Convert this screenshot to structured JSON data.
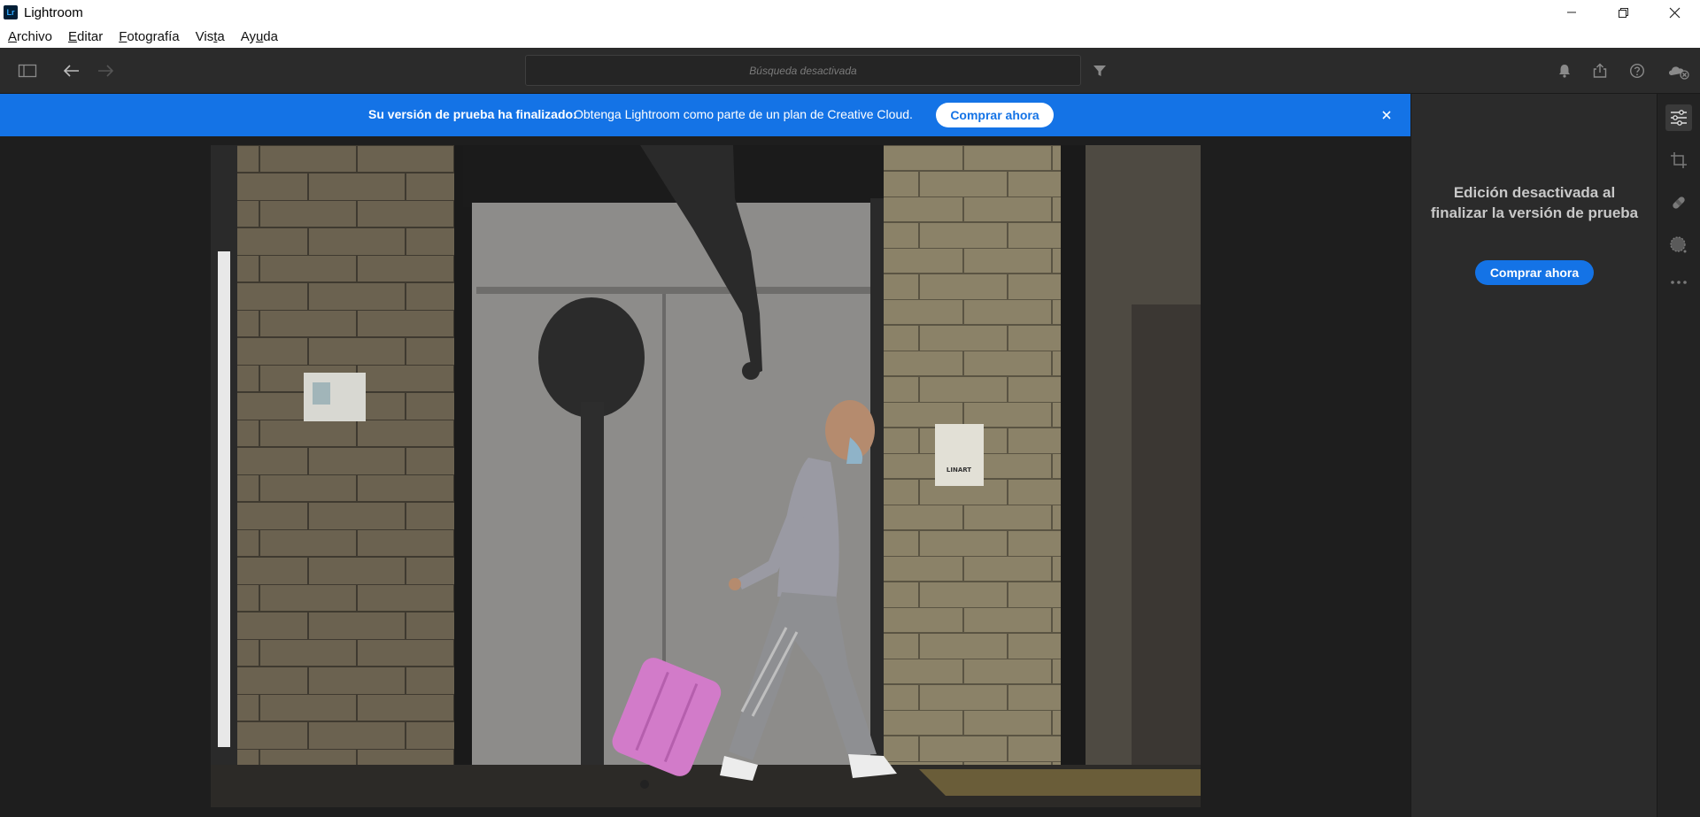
{
  "window": {
    "title": "Lightroom",
    "logo_text": "Lr"
  },
  "menu": {
    "items": [
      {
        "label": "Archivo",
        "key": "A",
        "rest": "rchivo"
      },
      {
        "label": "Editar",
        "key": "E",
        "rest": "ditar"
      },
      {
        "label": "Fotografía",
        "key": "F",
        "rest": "otografía"
      },
      {
        "label": "Vista",
        "pre": "Vis",
        "key": "t",
        "rest": "a"
      },
      {
        "label": "Ayuda",
        "pre": "Ay",
        "key": "u",
        "rest": "da"
      }
    ]
  },
  "toolbar": {
    "search_placeholder": "Búsqueda desactivada"
  },
  "banner": {
    "strong": "Su versión de prueba ha finalizado:",
    "text": "Obtenga Lightroom como parte de un plan de Creative Cloud.",
    "button": "Comprar ahora",
    "bg_color": "#1473e6"
  },
  "panel": {
    "message_line1": "Edición desactivada al",
    "message_line2": "finalizar la versión de prueba",
    "button": "Comprar ahora"
  },
  "photo": {
    "notice_text": "LINART",
    "suitcase_color": "#d27bc9"
  },
  "icons": [
    "sidebar-toggle-icon",
    "back-arrow-icon",
    "forward-arrow-icon",
    "filter-icon",
    "bell-icon",
    "share-icon",
    "help-icon",
    "cloud-icon",
    "edit-sliders-icon",
    "crop-icon",
    "healing-icon",
    "masking-icon",
    "more-icon",
    "close-icon"
  ]
}
